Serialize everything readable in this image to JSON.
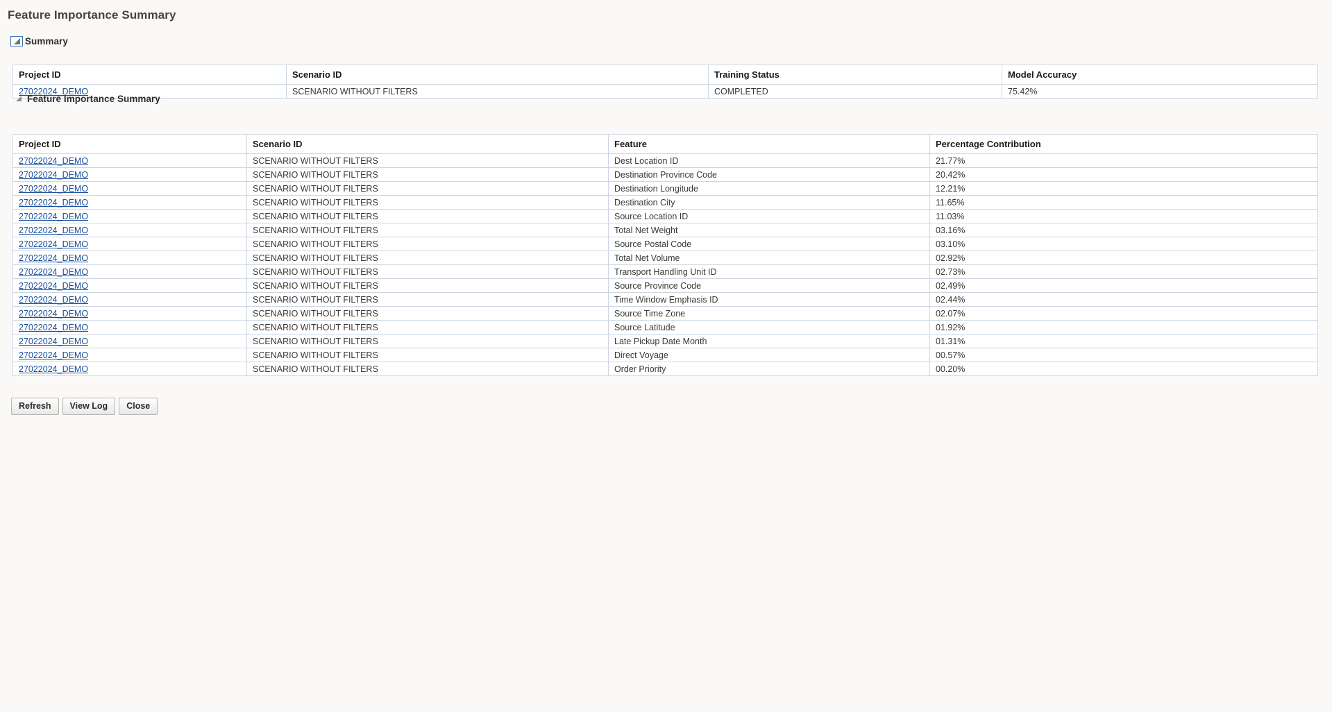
{
  "page": {
    "title": "Feature Importance Summary",
    "background_color": "#faf9f8",
    "border_color": "#ccd6e2",
    "link_color": "#1a4f9c"
  },
  "sections": {
    "summary": {
      "label": "Summary",
      "disclosure_icon": "triangle-collapse-icon"
    },
    "feature_importance": {
      "label": "Feature Importance Summary",
      "disclosure_icon": "triangle-collapse-icon"
    }
  },
  "summary_table": {
    "columns": [
      "Project ID",
      "Scenario ID",
      "Training Status",
      "Model Accuracy"
    ],
    "rows": [
      {
        "project_id": "27022024_DEMO",
        "scenario_id": "SCENARIO WITHOUT FILTERS",
        "training_status": "COMPLETED",
        "model_accuracy": "75.42%"
      }
    ]
  },
  "feature_table": {
    "columns": [
      "Project ID",
      "Scenario ID",
      "Feature",
      "Percentage Contribution"
    ],
    "rows": [
      {
        "project_id": "27022024_DEMO",
        "scenario_id": "SCENARIO WITHOUT FILTERS",
        "feature": "Dest Location ID",
        "contribution": "21.77%"
      },
      {
        "project_id": "27022024_DEMO",
        "scenario_id": "SCENARIO WITHOUT FILTERS",
        "feature": "Destination Province Code",
        "contribution": "20.42%"
      },
      {
        "project_id": "27022024_DEMO",
        "scenario_id": "SCENARIO WITHOUT FILTERS",
        "feature": "Destination Longitude",
        "contribution": "12.21%"
      },
      {
        "project_id": "27022024_DEMO",
        "scenario_id": "SCENARIO WITHOUT FILTERS",
        "feature": "Destination City",
        "contribution": "11.65%"
      },
      {
        "project_id": "27022024_DEMO",
        "scenario_id": "SCENARIO WITHOUT FILTERS",
        "feature": "Source Location ID",
        "contribution": "11.03%"
      },
      {
        "project_id": "27022024_DEMO",
        "scenario_id": "SCENARIO WITHOUT FILTERS",
        "feature": "Total Net Weight",
        "contribution": "03.16%"
      },
      {
        "project_id": "27022024_DEMO",
        "scenario_id": "SCENARIO WITHOUT FILTERS",
        "feature": "Source Postal Code",
        "contribution": "03.10%"
      },
      {
        "project_id": "27022024_DEMO",
        "scenario_id": "SCENARIO WITHOUT FILTERS",
        "feature": "Total Net Volume",
        "contribution": "02.92%"
      },
      {
        "project_id": "27022024_DEMO",
        "scenario_id": "SCENARIO WITHOUT FILTERS",
        "feature": "Transport Handling Unit ID",
        "contribution": "02.73%"
      },
      {
        "project_id": "27022024_DEMO",
        "scenario_id": "SCENARIO WITHOUT FILTERS",
        "feature": "Source Province Code",
        "contribution": "02.49%"
      },
      {
        "project_id": "27022024_DEMO",
        "scenario_id": "SCENARIO WITHOUT FILTERS",
        "feature": "Time Window Emphasis ID",
        "contribution": "02.44%"
      },
      {
        "project_id": "27022024_DEMO",
        "scenario_id": "SCENARIO WITHOUT FILTERS",
        "feature": "Source Time Zone",
        "contribution": "02.07%"
      },
      {
        "project_id": "27022024_DEMO",
        "scenario_id": "SCENARIO WITHOUT FILTERS",
        "feature": "Source Latitude",
        "contribution": "01.92%"
      },
      {
        "project_id": "27022024_DEMO",
        "scenario_id": "SCENARIO WITHOUT FILTERS",
        "feature": "Late Pickup Date Month",
        "contribution": "01.31%"
      },
      {
        "project_id": "27022024_DEMO",
        "scenario_id": "SCENARIO WITHOUT FILTERS",
        "feature": "Direct Voyage",
        "contribution": "00.57%"
      },
      {
        "project_id": "27022024_DEMO",
        "scenario_id": "SCENARIO WITHOUT FILTERS",
        "feature": "Order Priority",
        "contribution": "00.20%"
      }
    ]
  },
  "buttons": [
    {
      "label": "Refresh",
      "name": "refresh-button"
    },
    {
      "label": "View Log",
      "name": "view-log-button"
    },
    {
      "label": "Close",
      "name": "close-button"
    }
  ]
}
